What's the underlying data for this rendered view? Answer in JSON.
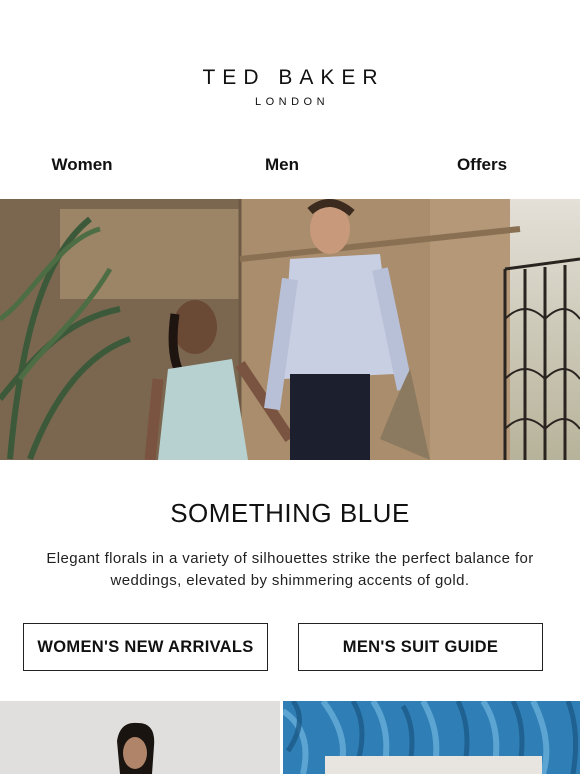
{
  "brand": {
    "name": "TED BAKER",
    "sub": "LONDON"
  },
  "nav": {
    "items": [
      "Women",
      "Men",
      "Offers"
    ]
  },
  "hero": {
    "alt": ""
  },
  "headline": "SOMETHING BLUE",
  "body": "Elegant florals in a variety of silhouettes strike the perfect balance for weddings, elevated by shimmering accents of gold.",
  "buttons": {
    "womens": "WOMEN'S NEW ARRIVALS",
    "mens": "MEN'S SUIT GUIDE"
  },
  "colors": {
    "text": "#111111",
    "background": "#ffffff",
    "border": "#222222",
    "accent_blue": "#2f7fb6"
  }
}
